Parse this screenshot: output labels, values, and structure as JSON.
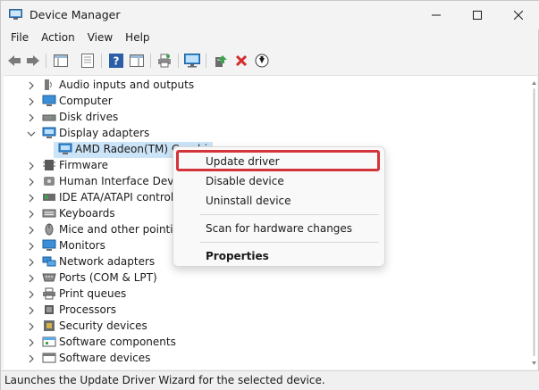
{
  "window": {
    "title": "Device Manager"
  },
  "window_controls": {
    "minimize_icon": "minimize-icon",
    "maximize_icon": "maximize-icon",
    "close_icon": "close-icon"
  },
  "menu": [
    "File",
    "Action",
    "View",
    "Help"
  ],
  "toolbar": {
    "buttons": [
      "back-arrow-icon",
      "forward-arrow-icon",
      "console-tree-icon",
      "properties-icon",
      "help-icon",
      "action-pane-icon",
      "print-icon",
      "monitor-icon",
      "add-driver-icon",
      "uninstall-x-icon",
      "download-icon"
    ]
  },
  "tree": {
    "items": [
      {
        "label": "Audio inputs and outputs",
        "icon": "speaker-icon",
        "expanded": false
      },
      {
        "label": "Computer",
        "icon": "computer-icon",
        "expanded": false
      },
      {
        "label": "Disk drives",
        "icon": "disk-icon",
        "expanded": false
      },
      {
        "label": "Display adapters",
        "icon": "display-adapter-icon",
        "expanded": true
      },
      {
        "label": "AMD Radeon(TM) Graphics",
        "icon": "display-adapter-icon",
        "child": true
      },
      {
        "label": "Firmware",
        "icon": "firmware-icon",
        "expanded": false
      },
      {
        "label": "Human Interface Devices",
        "icon": "hid-icon",
        "expanded": false
      },
      {
        "label": "IDE ATA/ATAPI controllers",
        "icon": "ide-controller-icon",
        "expanded": false
      },
      {
        "label": "Keyboards",
        "icon": "keyboard-icon",
        "expanded": false
      },
      {
        "label": "Mice and other pointing devices",
        "icon": "mouse-icon",
        "expanded": false
      },
      {
        "label": "Monitors",
        "icon": "monitor-icon",
        "expanded": false
      },
      {
        "label": "Network adapters",
        "icon": "network-icon",
        "expanded": false
      },
      {
        "label": "Ports (COM & LPT)",
        "icon": "port-icon",
        "expanded": false
      },
      {
        "label": "Print queues",
        "icon": "printer-icon",
        "expanded": false
      },
      {
        "label": "Processors",
        "icon": "processor-icon",
        "expanded": false
      },
      {
        "label": "Security devices",
        "icon": "security-icon",
        "expanded": false
      },
      {
        "label": "Software components",
        "icon": "software-component-icon",
        "expanded": false
      },
      {
        "label": "Software devices",
        "icon": "software-device-icon",
        "expanded": false
      }
    ]
  },
  "context_menu": {
    "items": [
      "Update driver",
      "Disable device",
      "Uninstall device",
      "Scan for hardware changes",
      "Properties"
    ],
    "highlighted": "Update driver",
    "highlight_color": "#d3343b"
  },
  "status_bar": {
    "text": "Launches the Update Driver Wizard for the selected device."
  },
  "colors": {
    "selection": "#cce4f7",
    "accent_red": "#d3343b",
    "window_bg": "#f3f3f3"
  }
}
